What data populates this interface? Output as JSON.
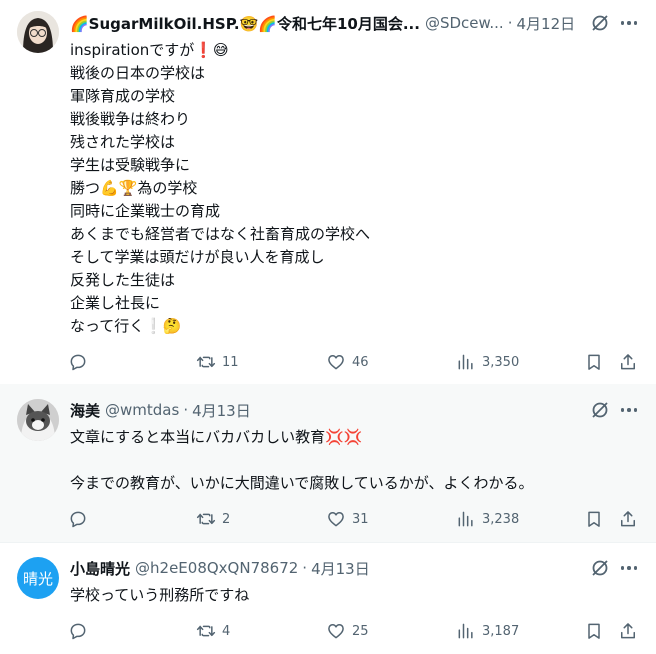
{
  "posts": [
    {
      "display_name": "🌈SugarMilkOil.HSP.🤓🌈令和七年10月国会...",
      "handle": "@SDcew...",
      "date": "4月12日",
      "lines": [
        "inspirationですが❗️😅",
        "戦後の日本の学校は",
        "軍隊育成の学校",
        "戦後戦争は終わり",
        "残された学校は",
        "学生は受験戦争に",
        "勝つ💪🏆為の学校",
        "同時に企業戦士の育成",
        "あくまでも経営者ではなく社畜育成の学校へ",
        "そして学業は頭だけが良い人を育成し",
        "反発した生徒は",
        "企業し社長に",
        "なって行く❕🤔"
      ],
      "stats": {
        "replies": "",
        "retweets": "11",
        "likes": "46",
        "views": "3,350"
      }
    },
    {
      "display_name": "海美",
      "handle": "@wmtdas",
      "date": "4月13日",
      "lines": [
        "文章にすると本当にバカバカしい教育💢💢",
        "",
        "今までの教育が、いかに大間違いで腐敗しているかが、よくわかる。"
      ],
      "stats": {
        "replies": "",
        "retweets": "2",
        "likes": "31",
        "views": "3,238"
      }
    },
    {
      "display_name": "小島晴光",
      "handle": "@h2eE08QxQN78672",
      "date": "4月13日",
      "avatar_text": "晴光",
      "lines": [
        "学校っていう刑務所ですね"
      ],
      "stats": {
        "replies": "",
        "retweets": "4",
        "likes": "25",
        "views": "3,187"
      }
    }
  ],
  "separator": "·",
  "colors": {
    "text": "#0f1419",
    "secondary": "#536471",
    "divider": "#eff3f4",
    "highlight_bg": "#f7f9f9",
    "avatar_blue": "#1da1f2"
  },
  "icons": [
    "reply-icon",
    "retweet-icon",
    "like-icon",
    "views-icon",
    "bookmark-icon",
    "share-icon",
    "grok-icon",
    "more-icon"
  ]
}
